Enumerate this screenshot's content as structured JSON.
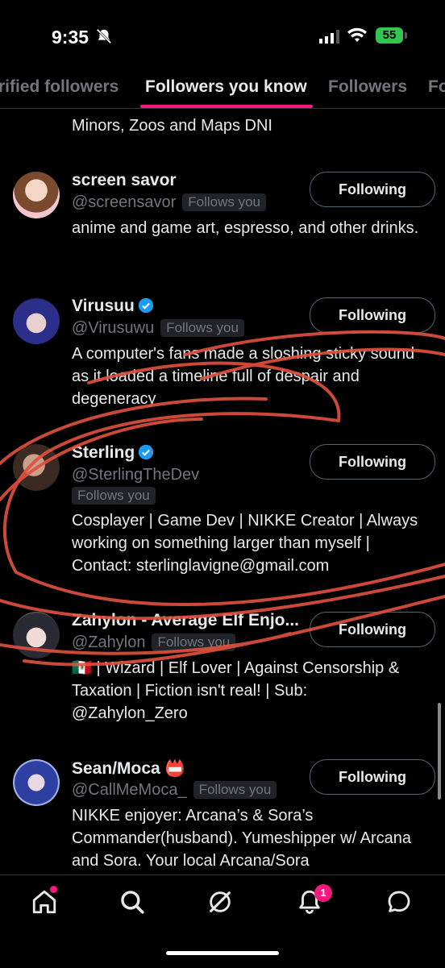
{
  "status": {
    "time": "9:35",
    "battery": "55"
  },
  "tabs": [
    "rified followers",
    "Followers you know",
    "Followers",
    "Fo"
  ],
  "partial_bio": "Minors, Zoos and Maps DNI",
  "follow_button_label": "Following",
  "follows_you_label": "Follows you",
  "users": [
    {
      "name": "screen savor",
      "handle": "@screensavor",
      "bio": "anime and game art, espresso, and other drinks."
    },
    {
      "name": "Virusuu",
      "handle": "@Virusuwu",
      "bio": "A computer's fans made a sloshing sticky sound as it loaded a timeline full of despair and degeneracy"
    },
    {
      "name": "Sterling",
      "handle": "@SterlingTheDev",
      "bio": "Cosplayer | Game Dev | NIKKE Creator | Always working on something larger than myself | Contact: sterlinglavigne@gmail.com"
    },
    {
      "name": "Zahylon - Average Elf Enjo...",
      "handle": "@Zahylon",
      "bio": "🇲🇽 | Wizard | Elf Lover | Against Censorship & Taxation | Fiction isn't real! | Sub: @Zahylon_Zero"
    },
    {
      "name": "Sean/Moca",
      "name_emoji": "📛",
      "handle": "@CallMeMoca_",
      "bio": "NIKKE enjoyer: Arcana’s & Sora’s Commander(husband). Yumeshipper w/ Arcana and Sora. Your local Arcana/Sora"
    }
  ],
  "nav": {
    "notification_count": "1"
  },
  "colors": {
    "accent": "#f91880",
    "verified": "#1d9bf0",
    "scribble": "#e0523f"
  }
}
